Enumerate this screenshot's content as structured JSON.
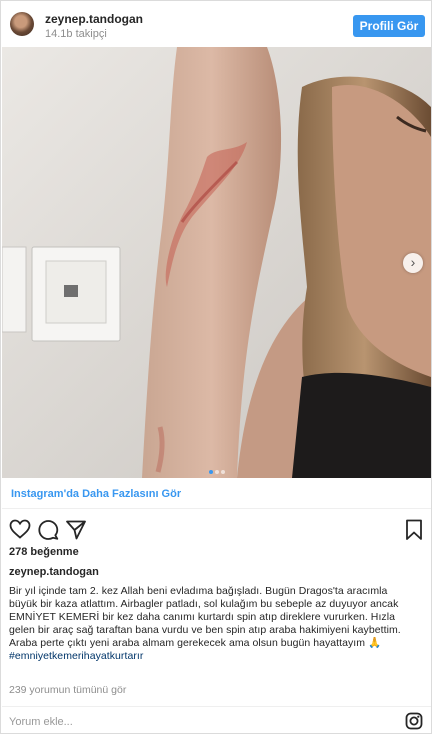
{
  "header": {
    "username": "zeynep.tandogan",
    "followers": "14.1b takipçi",
    "profile_button": "Profili Gör"
  },
  "carousel": {
    "slide_count": 3,
    "active_index": 0
  },
  "more_link": "Instagram'da Daha Fazlasını Gör",
  "likes": "278 beğenme",
  "caption": {
    "username": "zeynep.tandogan",
    "lines": [
      "Bir yıl içinde tam 2. kez Allah beni evladıma bağışladı. Bugün Dragos'ta aracımla",
      "büyük bir kaza atlattım. Airbagler patladı, sol kulağım bu sebeple az duyuyor ancak",
      "EMNİYET KEMERİ bir kez daha canımı kurtardı spin atıp direklere vururken. Hızla",
      "gelen bir araç sağ taraftan bana vurdu ve ben spin atıp araba hakimiyeni kaybettim.",
      "Araba perte çıktı yeni araba almam gerekecek ama olsun bugün hayattayım 🙏"
    ],
    "hashtag": "#emniyetkemerihayatkurtarır"
  },
  "comments_link": "239 yorumun tümünü gör",
  "comment_placeholder": "Yorum ekle...",
  "icons": [
    "heart-icon",
    "comment-icon",
    "share-icon",
    "bookmark-icon",
    "instagram-logo-icon",
    "chevron-right-icon"
  ],
  "colors": {
    "accent": "#3897f0",
    "hashtag": "#003569",
    "muted": "#8e8e8e"
  }
}
